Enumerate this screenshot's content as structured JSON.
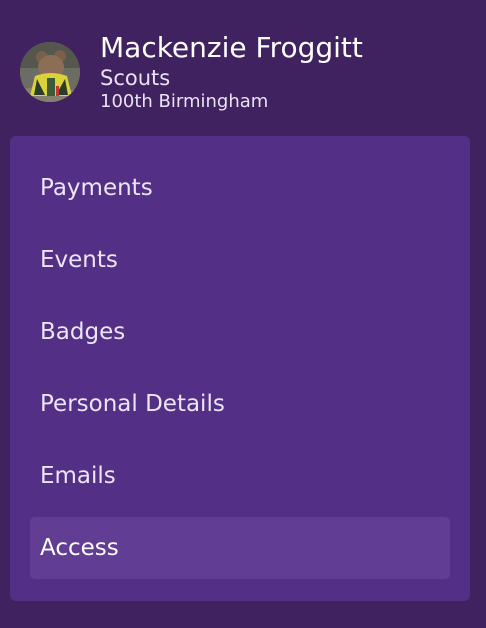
{
  "profile": {
    "name": "Mackenzie Froggitt",
    "section": "Scouts",
    "group": "100th Birmingham"
  },
  "menu": {
    "items": [
      {
        "label": "Payments"
      },
      {
        "label": "Events"
      },
      {
        "label": "Badges"
      },
      {
        "label": "Personal Details"
      },
      {
        "label": "Emails"
      },
      {
        "label": "Access"
      }
    ],
    "active_item": "Access"
  },
  "colors": {
    "background": "#3f225f",
    "menu_panel": "#533086",
    "active_item": "#613d94",
    "text": "#ffffff"
  }
}
